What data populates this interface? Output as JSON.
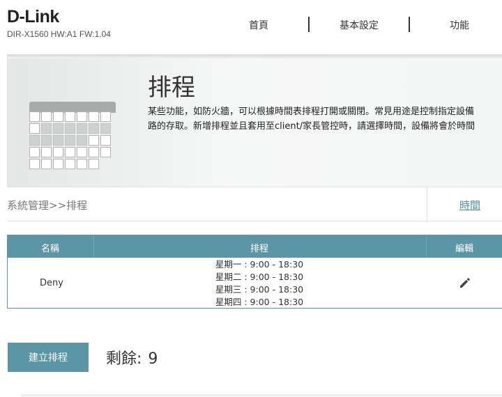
{
  "header": {
    "logo": "D-Link",
    "model_info": "DIR-X1560 HW:A1 FW:1.04",
    "nav": [
      "首頁",
      "基本設定",
      "功能"
    ]
  },
  "banner": {
    "title": "排程",
    "description_line1": "某些功能，如防火牆，可以根據時間表排程打開或關閉。常見用途是控制指定設備",
    "description_line2": "路的存取。新增排程並且套用至client/家長管控時，請選擇時間，設備將會於時間"
  },
  "breadcrumb": {
    "text": "系統管理>>排程",
    "time_link": "時間"
  },
  "table": {
    "headers": {
      "name": "名稱",
      "schedule": "排程",
      "edit": "編輯"
    },
    "rows": [
      {
        "name": "Deny",
        "schedule": [
          "星期一 : 9:00 - 18:30",
          "星期二 : 9:00 - 18:30",
          "星期三 : 9:00 - 18:30",
          "星期四 : 9:00 - 18:30"
        ],
        "edit_icon": "pencil-icon"
      }
    ]
  },
  "footer": {
    "create_button": "建立排程",
    "remaining_label": "剩餘:",
    "remaining_value": "9"
  },
  "colors": {
    "accent": "#5b96a6",
    "link": "#4e8ea0"
  },
  "icons": {
    "banner": "calendar-icon",
    "edit": "pencil-icon"
  }
}
